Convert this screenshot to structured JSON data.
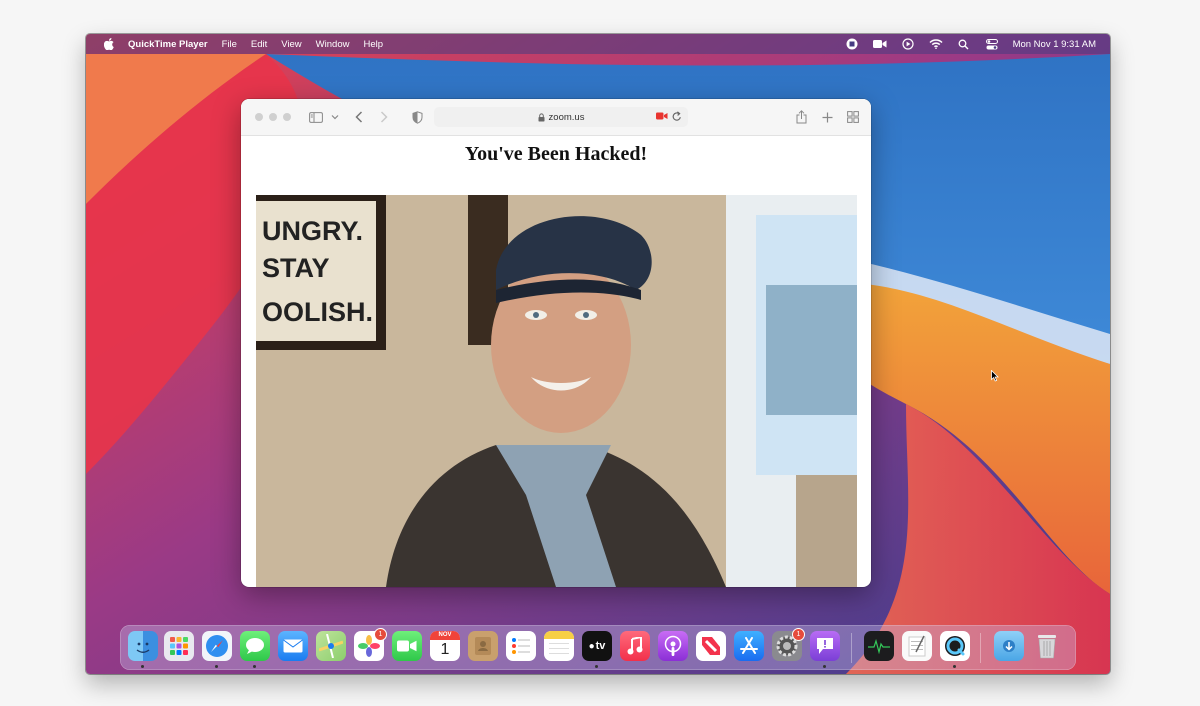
{
  "menubar": {
    "app_name": "QuickTime Player",
    "items": [
      "File",
      "Edit",
      "View",
      "Window",
      "Help"
    ],
    "clock": "Mon Nov 1  9:31 AM",
    "status_icons": [
      "stop-recording-icon",
      "facetime-camera-icon",
      "play-circle-icon",
      "wifi-icon",
      "spotlight-search-icon",
      "control-center-icon"
    ]
  },
  "browser": {
    "address": "zoom.us",
    "page_heading": "You've Been Hacked!"
  },
  "dock": {
    "apps": [
      {
        "name": "Finder",
        "icon": "finder-icon",
        "running": true
      },
      {
        "name": "Launchpad",
        "icon": "launchpad-icon",
        "running": false
      },
      {
        "name": "Safari",
        "icon": "safari-icon",
        "running": true
      },
      {
        "name": "Messages",
        "icon": "messages-icon",
        "running": true
      },
      {
        "name": "Mail",
        "icon": "mail-icon",
        "running": false
      },
      {
        "name": "Maps",
        "icon": "maps-icon",
        "running": false
      },
      {
        "name": "Photos",
        "icon": "photos-icon",
        "running": false,
        "badge": "1"
      },
      {
        "name": "FaceTime",
        "icon": "facetime-icon",
        "running": false
      },
      {
        "name": "Calendar",
        "icon": "calendar-icon",
        "running": false,
        "month": "NOV",
        "day": "1"
      },
      {
        "name": "Contacts",
        "icon": "contacts-icon",
        "running": false
      },
      {
        "name": "Reminders",
        "icon": "reminders-icon",
        "running": false
      },
      {
        "name": "Notes",
        "icon": "notes-icon",
        "running": false
      },
      {
        "name": "Apple TV",
        "icon": "apple-tv-icon",
        "running": true,
        "label": "tv"
      },
      {
        "name": "Music",
        "icon": "music-icon",
        "running": false
      },
      {
        "name": "Podcasts",
        "icon": "podcasts-icon",
        "running": false
      },
      {
        "name": "News",
        "icon": "news-icon",
        "running": false
      },
      {
        "name": "App Store",
        "icon": "app-store-icon",
        "running": false
      },
      {
        "name": "System Preferences",
        "icon": "system-preferences-icon",
        "running": false,
        "badge": "1"
      },
      {
        "name": "Feedback Assistant",
        "icon": "feedback-assistant-icon",
        "running": true
      },
      {
        "name": "Activity Monitor",
        "icon": "activity-monitor-icon",
        "running": false
      },
      {
        "name": "TextEdit",
        "icon": "textedit-icon",
        "running": false
      },
      {
        "name": "QuickTime Player",
        "icon": "quicktime-icon",
        "running": true
      },
      {
        "name": "Downloads",
        "icon": "downloads-folder-icon",
        "running": false
      },
      {
        "name": "Trash",
        "icon": "trash-icon",
        "running": false
      }
    ]
  },
  "colors": {
    "menubar_bg": "#463c82",
    "record_red": "#e8342f",
    "badge_red": "#e64b3c"
  }
}
